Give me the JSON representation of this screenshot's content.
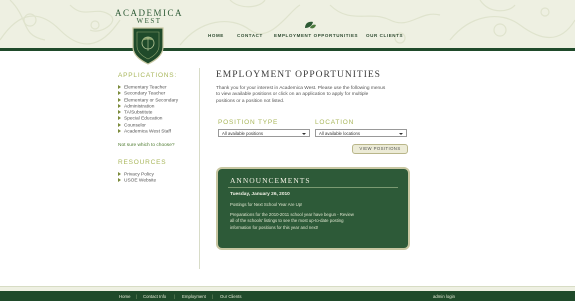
{
  "brand": {
    "name_line1": "ACADEMICA",
    "name_line2": "WEST",
    "primary_color": "#1f4a2a",
    "accent_color": "#a8b65a"
  },
  "nav": {
    "items": [
      "HOME",
      "CONTACT",
      "EMPLOYMENT OPPORTUNITIES",
      "OUR CLIENTS"
    ]
  },
  "sidebar": {
    "applications_heading": "APPLICATIONS:",
    "applications": [
      "Elementary Teacher",
      "Secondary Teacher",
      "Elementary or Secondary",
      "Administration",
      "TA/Substitute",
      "Special Education",
      "Counselor",
      "Academica West Staff"
    ],
    "not_sure_link": "Not sure which to choose?",
    "resources_heading": "RESOURCES",
    "resources": [
      "Privacy Policy",
      "USOE Website"
    ]
  },
  "main": {
    "title": "EMPLOYMENT OPPORTUNITIES",
    "intro_line1": "Thank you for your interest in Academica West. Please use the following menus",
    "intro_line2": "to view available positions or click on an application to apply for multiple",
    "intro_line3": "positions or a position not listed.",
    "position_type_label": "POSITION TYPE",
    "position_type_value": "All available positions",
    "location_label": "LOCATION",
    "location_value": "All available locations",
    "view_button": "VIEW POSITIONS"
  },
  "announcements": {
    "title": "ANNOUNCEMENTS",
    "date": "Tuesday, January 26, 2010",
    "post1": "Postings for Next School Year Are Up!",
    "post2_line1": "Preparations for the 2010-2011 school year have begun - Review",
    "post2_line2": "all of the schools' listings to see the most up-to-date posting",
    "post2_line3": "information for positions for this year and next!"
  },
  "footer": {
    "links": [
      "Home",
      "Contact Info",
      "Employment",
      "Our Clients"
    ],
    "separator": "|",
    "admin_login": "admin login"
  }
}
